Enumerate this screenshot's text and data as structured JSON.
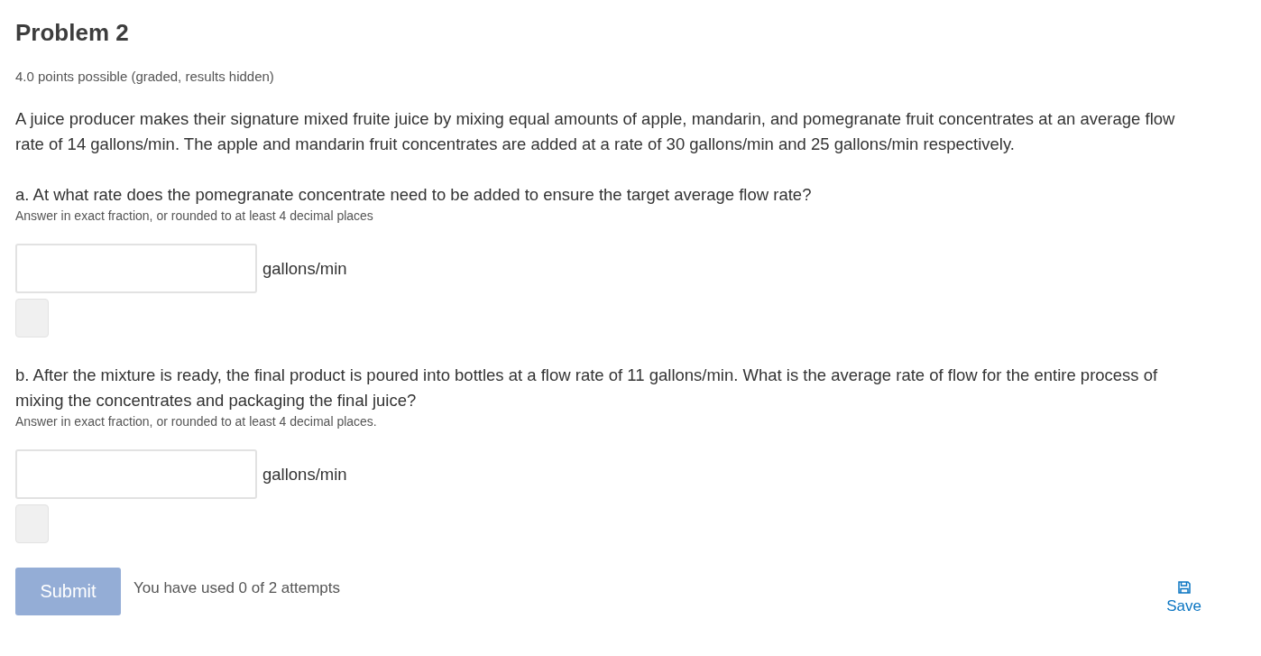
{
  "title": "Problem 2",
  "points": "4.0 points possible (graded, results hidden)",
  "intro": "A juice producer makes their signature mixed fruite juice by mixing equal amounts of apple, mandarin, and pomegranate fruit concentrates at an average flow rate of 14 gallons/min. The apple and mandarin fruit concentrates are added at a rate of 30 gallons/min and 25 gallons/min respectively.",
  "parts": [
    {
      "question": "a. At what rate does the pomegranate concentrate need to be added to ensure the target average flow rate?",
      "hint": "Answer in exact fraction, or rounded to at least 4 decimal places",
      "unit": "gallons/min"
    },
    {
      "question": "b. After the mixture is ready, the final product is poured into bottles at a flow rate of 11 gallons/min. What is the average rate of flow for the entire process of mixing the concentrates and packaging the final juice?",
      "hint": "Answer in exact fraction, or rounded to at least 4 decimal places.",
      "unit": "gallons/min"
    }
  ],
  "submit": {
    "label": "Submit",
    "disabled": true
  },
  "attempts": "You have used 0 of 2 attempts",
  "save": {
    "label": "Save"
  }
}
